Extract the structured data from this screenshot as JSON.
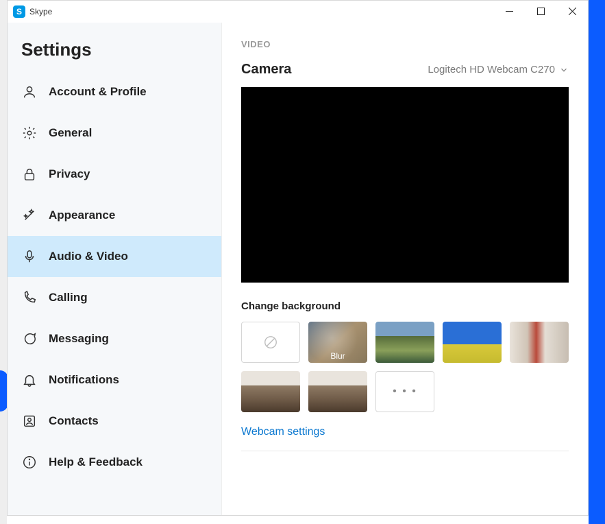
{
  "app": {
    "title": "Skype",
    "icon_letter": "S"
  },
  "sidebar": {
    "title": "Settings",
    "items": [
      {
        "label": "Account & Profile",
        "icon": "person"
      },
      {
        "label": "General",
        "icon": "gear"
      },
      {
        "label": "Privacy",
        "icon": "lock"
      },
      {
        "label": "Appearance",
        "icon": "wand"
      },
      {
        "label": "Audio & Video",
        "icon": "mic",
        "active": true
      },
      {
        "label": "Calling",
        "icon": "phone"
      },
      {
        "label": "Messaging",
        "icon": "chat"
      },
      {
        "label": "Notifications",
        "icon": "bell"
      },
      {
        "label": "Contacts",
        "icon": "contacts"
      },
      {
        "label": "Help & Feedback",
        "icon": "info"
      }
    ]
  },
  "content": {
    "section_label": "VIDEO",
    "camera_label": "Camera",
    "camera_selected": "Logitech HD Webcam C270",
    "change_bg_label": "Change background",
    "blur_label": "Blur",
    "more_label": "• • •",
    "webcam_link": "Webcam settings"
  }
}
